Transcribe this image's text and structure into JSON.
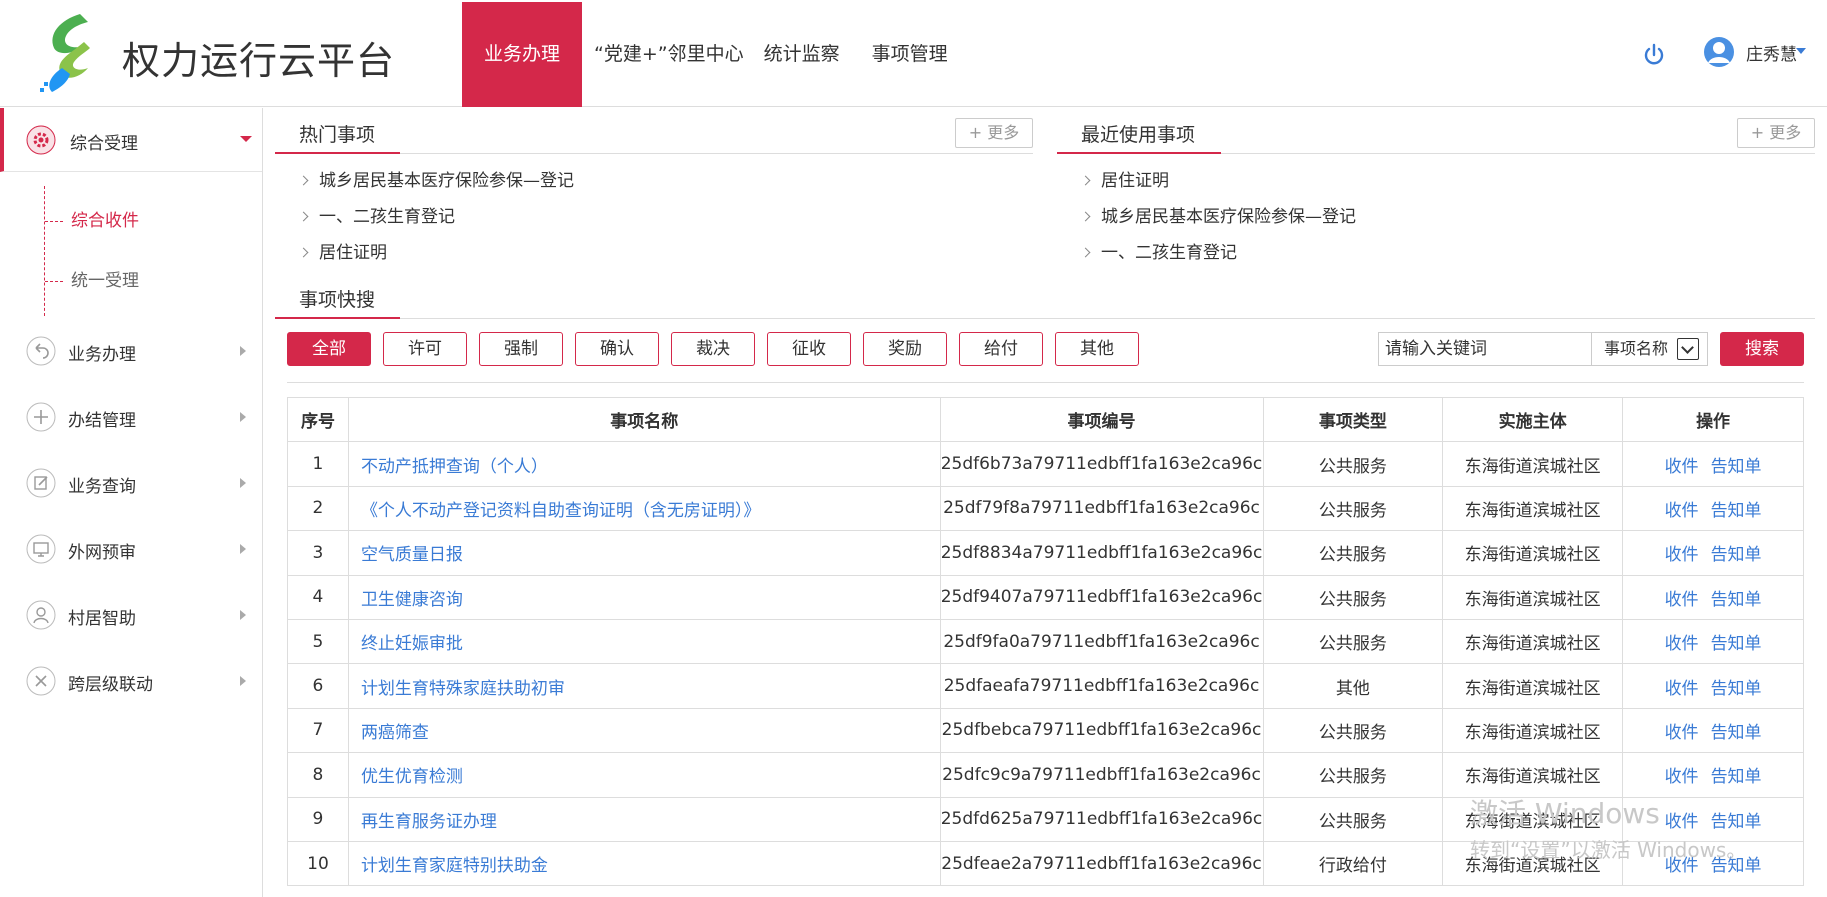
{
  "header": {
    "title": "权力运行云平台",
    "nav": [
      "业务办理",
      "“党建+”邻里中心",
      "统计监察",
      "事项管理"
    ],
    "user": "庄秀慧",
    "accent": "#d4284a"
  },
  "sidebar": {
    "top": {
      "label": "综合受理"
    },
    "sub": [
      "综合收件",
      "统一受理"
    ],
    "items": [
      "业务办理",
      "办结管理",
      "业务查询",
      "外网预审",
      "村居智助",
      "跨层级联动"
    ]
  },
  "hot": {
    "title": "热门事项",
    "more": "+ 更多",
    "items": [
      "城乡居民基本医疗保险参保—登记",
      "一、二孩生育登记",
      "居住证明"
    ]
  },
  "recent": {
    "title": "最近使用事项",
    "more": "+ 更多",
    "items": [
      "居住证明",
      "城乡居民基本医疗保险参保—登记",
      "一、二孩生育登记"
    ]
  },
  "quick": {
    "title": "事项快搜",
    "filters": [
      "全部",
      "许可",
      "强制",
      "确认",
      "裁决",
      "征收",
      "奖励",
      "给付",
      "其他"
    ],
    "search_placeholder": "请输入关键词",
    "select_value": "事项名称",
    "search_button": "搜索"
  },
  "table": {
    "headers": [
      "序号",
      "事项名称",
      "事项编号",
      "事项类型",
      "实施主体",
      "操作"
    ],
    "rows": [
      [
        "1",
        "不动产抵押查询（个人）",
        "25df6b73a79711edbff1fa163e2ca96c",
        "公共服务",
        "东海街道滨城社区"
      ],
      [
        "2",
        "《个人不动产登记资料自助查询证明（含无房证明）》",
        "25df79f8a79711edbff1fa163e2ca96c",
        "公共服务",
        "东海街道滨城社区"
      ],
      [
        "3",
        "空气质量日报",
        "25df8834a79711edbff1fa163e2ca96c",
        "公共服务",
        "东海街道滨城社区"
      ],
      [
        "4",
        "卫生健康咨询",
        "25df9407a79711edbff1fa163e2ca96c",
        "公共服务",
        "东海街道滨城社区"
      ],
      [
        "5",
        "终止妊娠审批",
        "25df9fa0a79711edbff1fa163e2ca96c",
        "公共服务",
        "东海街道滨城社区"
      ],
      [
        "6",
        "计划生育特殊家庭扶助初审",
        "25dfaeafa79711edbff1fa163e2ca96c",
        "其他",
        "东海街道滨城社区"
      ],
      [
        "7",
        "两癌筛查",
        "25dfbebca79711edbff1fa163e2ca96c",
        "公共服务",
        "东海街道滨城社区"
      ],
      [
        "8",
        "优生优育检测",
        "25dfc9c9a79711edbff1fa163e2ca96c",
        "公共服务",
        "东海街道滨城社区"
      ],
      [
        "9",
        "再生育服务证办理",
        "25dfd625a79711edbff1fa163e2ca96c",
        "公共服务",
        "东海街道滨城社区"
      ],
      [
        "10",
        "计划生育家庭特别扶助金",
        "25dfeae2a79711edbff1fa163e2ca96c",
        "行政给付",
        "东海街道滨城社区"
      ]
    ],
    "op_receive": "收件",
    "op_notice": "告知单"
  },
  "watermark": {
    "line1": "激活 Windows",
    "line2": "转到“设置”以激活 Windows。"
  }
}
